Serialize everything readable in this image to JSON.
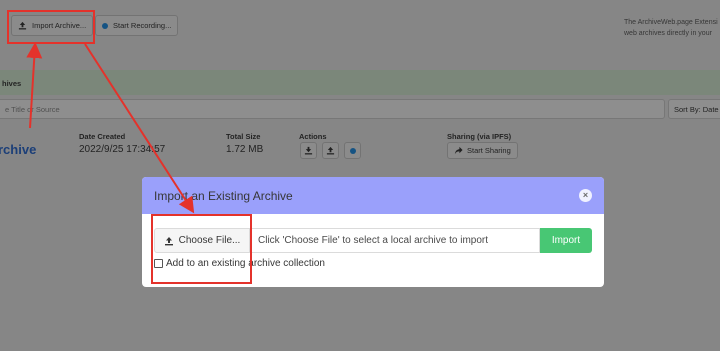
{
  "toolbar": {
    "import_label": "Import Archive...",
    "record_label": "Start Recording..."
  },
  "side_note": {
    "line1": "The ArchiveWeb.page Extensi",
    "line2": "web archives directly in your"
  },
  "archives": {
    "header": "hives",
    "search_placeholder": "e Title or Source",
    "sort_label": "Sort By: Date Cr"
  },
  "columns": {
    "date_created": "Date Created",
    "total_size": "Total Size",
    "actions": "Actions",
    "sharing": "Sharing (via IPFS)"
  },
  "archive_item": {
    "title": "rchive",
    "date": "2022/9/25 17:34:57",
    "size": "1.72 MB",
    "share_label": "Start Sharing"
  },
  "modal": {
    "title": "Import an Existing Archive",
    "choose_label": "Choose File...",
    "file_placeholder": "Click 'Choose File' to select a local archive to import",
    "import_label": "Import",
    "checkbox_label": "Add to an existing archive collection"
  },
  "colors": {
    "accent_blue": "#1e8fe6",
    "title_blue": "#2b6ad1",
    "modal_header": "#9aa0fb",
    "import_green": "#48c774",
    "annotation_red": "#e4322b"
  }
}
